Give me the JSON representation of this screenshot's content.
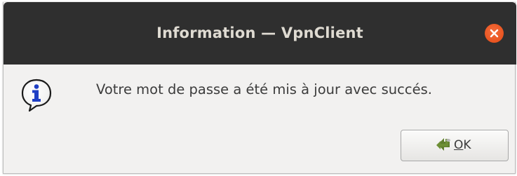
{
  "window": {
    "title": "Information — VpnClient",
    "close_icon": "close-icon",
    "accent_color": "#e95420"
  },
  "dialog": {
    "icon": "info-icon",
    "message": "Votre mot de passe a été mis à jour avec succés."
  },
  "buttons": {
    "ok_mnemonic": "O",
    "ok_rest": "K",
    "ok_icon": "ok-check-icon"
  }
}
